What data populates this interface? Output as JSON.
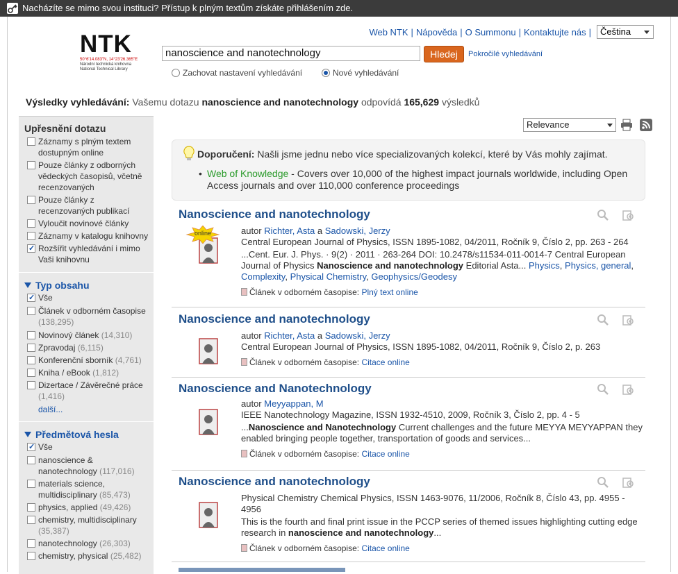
{
  "topbar": {
    "message": "Nacházíte se mimo svou instituci? Přístup k plným textům získáte přihlášením zde."
  },
  "logo": {
    "name": "NTK",
    "coords": "50°6'14.083\"N, 14°23'26.365\"E",
    "line1": "Národní technická knihovna",
    "line2": "National Technical Library"
  },
  "toplinks": [
    "Web NTK",
    "Nápověda",
    "O Summonu",
    "Kontaktujte nás"
  ],
  "language": "Čeština",
  "search": {
    "value": "nanoscience and nanotechnology",
    "button": "Hledej",
    "advanced": "Pokročilé vyhledávání",
    "radio_keep": "Zachovat nastavení vyhledávání",
    "radio_new": "Nové vyhledávání"
  },
  "summary": {
    "label": "Výsledky vyhledávání:",
    "prefix": "Vašemu dotazu",
    "query": "nanoscience and nanotechnology",
    "mid": "odpovídá",
    "count": "165,629",
    "suffix": "výsledků"
  },
  "sidebar": {
    "refine_title": "Upřesnění dotazu",
    "refine": [
      {
        "label": "Záznamy s plným textem dostupným online",
        "checked": false
      },
      {
        "label": "Pouze články z odborných vědeckých časopisů, včetně recenzovaných",
        "checked": false
      },
      {
        "label": "Pouze články z recenzovaných publikací",
        "checked": false
      },
      {
        "label": "Vyloučit novinové články",
        "checked": false
      },
      {
        "label": "Záznamy v katalogu knihovny",
        "checked": false
      },
      {
        "label": "Rozšířit vyhledávání i mimo Vaši knihovnu",
        "checked": true
      }
    ],
    "type_title": "Typ obsahu",
    "types": [
      {
        "label": "Vše",
        "count": "",
        "checked": true
      },
      {
        "label": "Článek v odborném časopise",
        "count": "(138,295)",
        "checked": false
      },
      {
        "label": "Novinový článek",
        "count": "(14,310)",
        "checked": false
      },
      {
        "label": "Zpravodaj",
        "count": "(6,115)",
        "checked": false
      },
      {
        "label": "Konferenční sborník",
        "count": "(4,761)",
        "checked": false
      },
      {
        "label": "Kniha / eBook",
        "count": "(1,812)",
        "checked": false
      },
      {
        "label": "Dizertace / Závěrečné práce",
        "count": "(1,416)",
        "checked": false
      }
    ],
    "more": "další...",
    "subject_title": "Předmětová hesla",
    "subjects": [
      {
        "label": "Vše",
        "count": "",
        "checked": true
      },
      {
        "label": "nanoscience & nanotechnology",
        "count": "(117,016)",
        "checked": false
      },
      {
        "label": "materials science, multidisciplinary",
        "count": "(85,473)",
        "checked": false
      },
      {
        "label": "physics, applied",
        "count": "(49,426)",
        "checked": false
      },
      {
        "label": "chemistry, multidisciplinary",
        "count": "(35,387)",
        "checked": false
      },
      {
        "label": "nanotechnology",
        "count": "(26,303)",
        "checked": false
      },
      {
        "label": "chemistry, physical",
        "count": "(25,482)",
        "checked": false
      }
    ]
  },
  "sort": "Relevance",
  "recommend": {
    "label": "Doporučení:",
    "text": "Našli jsme jednu nebo více specializovaných kolekcí, které by Vás mohly zajímat.",
    "link": "Web of Knowledge",
    "desc": " - Covers over 10,000 of the highest impact journals worldwide, including Open Access journals and over 110,000 conference proceedings"
  },
  "results": [
    {
      "title": "Nanoscience and nanotechnology",
      "author_label": "autor",
      "authors": [
        "Richter, Asta",
        "Sadowski, Jerzy"
      ],
      "source": "Central European Journal of Physics, ISSN 1895-1082, 04/2011, Ročník 9, Číslo 2, pp. 263 - 264",
      "snippet_a": "...Cent. Eur. J. Phys. · 9(2) · 2011 · 263-264 DOI: 10.2478/s11534-011-0014-7 Central European Journal of Physics ",
      "snippet_b": "Nanoscience and nanotechnology",
      "snippet_c": " Editorial Asta...",
      "subjects": [
        "Physics",
        "Physics, general",
        "Complexity",
        "Physical Chemistry",
        "Geophysics/Geodesy"
      ],
      "type": "Článek v odborném časopise:",
      "link": "Plný text online",
      "online_badge": "online"
    },
    {
      "title": "Nanoscience and nanotechnology",
      "author_label": "autor",
      "authors": [
        "Richter, Asta",
        "Sadowski, Jerzy"
      ],
      "source": "Central European Journal of Physics, ISSN 1895-1082, 04/2011, Ročník 9, Číslo 2, p. 263",
      "type": "Článek v odborném časopise:",
      "link": "Citace online"
    },
    {
      "title": "Nanoscience and Nanotechnology",
      "author_label": "autor",
      "authors": [
        "Meyyappan, M"
      ],
      "source": "IEEE Nanotechnology Magazine, ISSN 1932-4510, 2009, Ročník 3, Číslo 2, pp. 4 - 5",
      "snippet_a": "...",
      "snippet_b": "Nanoscience and Nanotechnology",
      "snippet_c": " Current challenges and the future MEYYA MEYYAPPAN they enabled bringing people together, transportation of goods and services...",
      "type": "Článek v odborném časopise:",
      "link": "Citace online"
    },
    {
      "title": "Nanoscience and nanotechnology",
      "source": "Physical Chemistry Chemical Physics, ISSN 1463-9076, 11/2006, Ročník 8, Číslo 43, pp. 4955 - 4956",
      "snippet_a": "This is the fourth and final print issue in the PCCP series of themed issues highlighting cutting edge research in ",
      "snippet_b": "nanoscience and nanotechnology",
      "snippet_c": "...",
      "type": "Článek v odborném časopise:",
      "link": "Citace online"
    }
  ]
}
